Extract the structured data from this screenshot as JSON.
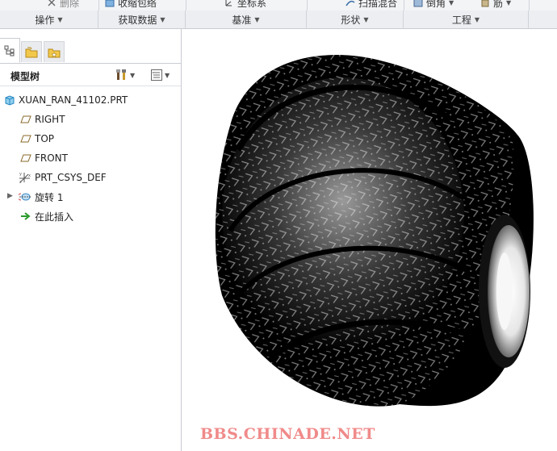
{
  "ribbon": {
    "cut_label": "删除",
    "shrinkwrap_label": "收缩包络",
    "csys_label": "坐标系",
    "sweep_label": "扫描混合",
    "draft_label": "倒角",
    "rib_label": "筋"
  },
  "groups": [
    {
      "label": "操作"
    },
    {
      "label": "获取数据"
    },
    {
      "label": "基准"
    },
    {
      "label": "形状"
    },
    {
      "label": "工程"
    }
  ],
  "panel": {
    "title": "模型树"
  },
  "tree": {
    "root": "XUAN_RAN_41102.PRT",
    "items": [
      {
        "label": "RIGHT",
        "icon": "datum-plane-icon"
      },
      {
        "label": "TOP",
        "icon": "datum-plane-icon"
      },
      {
        "label": "FRONT",
        "icon": "datum-plane-icon"
      },
      {
        "label": "PRT_CSYS_DEF",
        "icon": "coordinate-system-icon"
      },
      {
        "label": "旋转 1",
        "icon": "revolve-feature-icon"
      },
      {
        "label": "在此插入",
        "icon": "insert-here-arrow-icon"
      }
    ]
  },
  "watermark": "BBS.CHINADE.NET",
  "colors": {
    "watermark": "#f08a8a",
    "insert_arrow": "#2a9a2a",
    "datum_plane": "#b08a3a"
  }
}
